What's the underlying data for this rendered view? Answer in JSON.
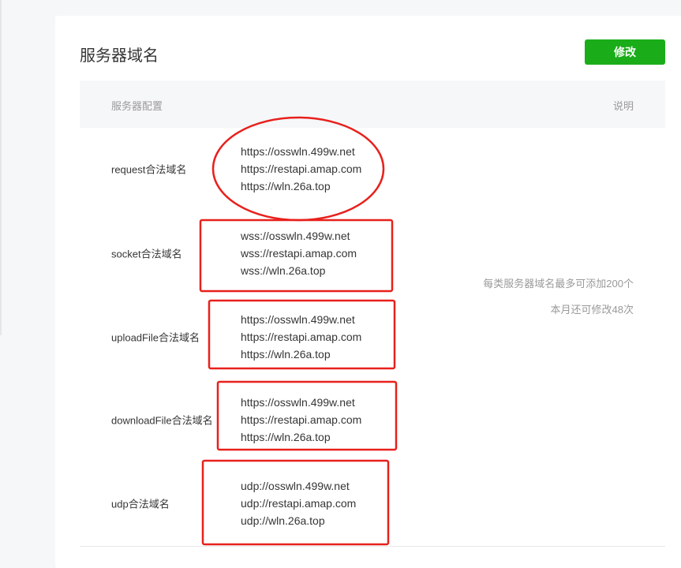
{
  "header": {
    "title": "服务器域名",
    "edit_label": "修改"
  },
  "table": {
    "col_config": "服务器配置",
    "col_desc": "说明",
    "rows": [
      {
        "label": "request合法域名",
        "values": [
          "https://osswln.499w.net",
          "https://restapi.amap.com",
          "https://wln.26a.top"
        ]
      },
      {
        "label": "socket合法域名",
        "values": [
          "wss://osswln.499w.net",
          "wss://restapi.amap.com",
          "wss://wln.26a.top"
        ]
      },
      {
        "label": "uploadFile合法域名",
        "values": [
          "https://osswln.499w.net",
          "https://restapi.amap.com",
          "https://wln.26a.top"
        ]
      },
      {
        "label": "downloadFile合法域名",
        "values": [
          "https://osswln.499w.net",
          "https://restapi.amap.com",
          "https://wln.26a.top"
        ]
      },
      {
        "label": "udp合法域名",
        "values": [
          "udp://osswln.499w.net",
          "udp://restapi.amap.com",
          "udp://wln.26a.top"
        ]
      }
    ],
    "notes": [
      "每类服务器域名最多可添加200个",
      "本月还可修改48次"
    ]
  },
  "annotation_color": "#e8201c"
}
